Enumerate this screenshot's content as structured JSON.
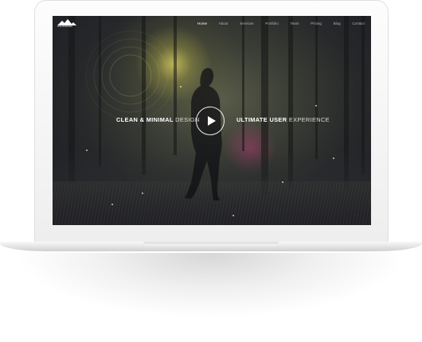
{
  "site": {
    "logo": {
      "icon": "mountains-icon",
      "text": "CALIFORNIA",
      "subtext": "Theme"
    },
    "nav": {
      "items": [
        "Home",
        "About",
        "Services",
        "Portfolio",
        "Team",
        "Pricing",
        "Blog",
        "Contact"
      ],
      "active": "Home"
    },
    "hero": {
      "left_headline": {
        "strong": "CLEAN & MINIMAL",
        "light": "DESIGN"
      },
      "right_headline": {
        "strong": "ULTIMATE USER",
        "light": "EXPERIENCE"
      },
      "play_icon": "play-icon"
    }
  },
  "colors": {
    "accent_glow": "#dcd25f",
    "background_dark": "#1b1c22",
    "text": "#ffffff",
    "device": "#f3f3f3"
  }
}
